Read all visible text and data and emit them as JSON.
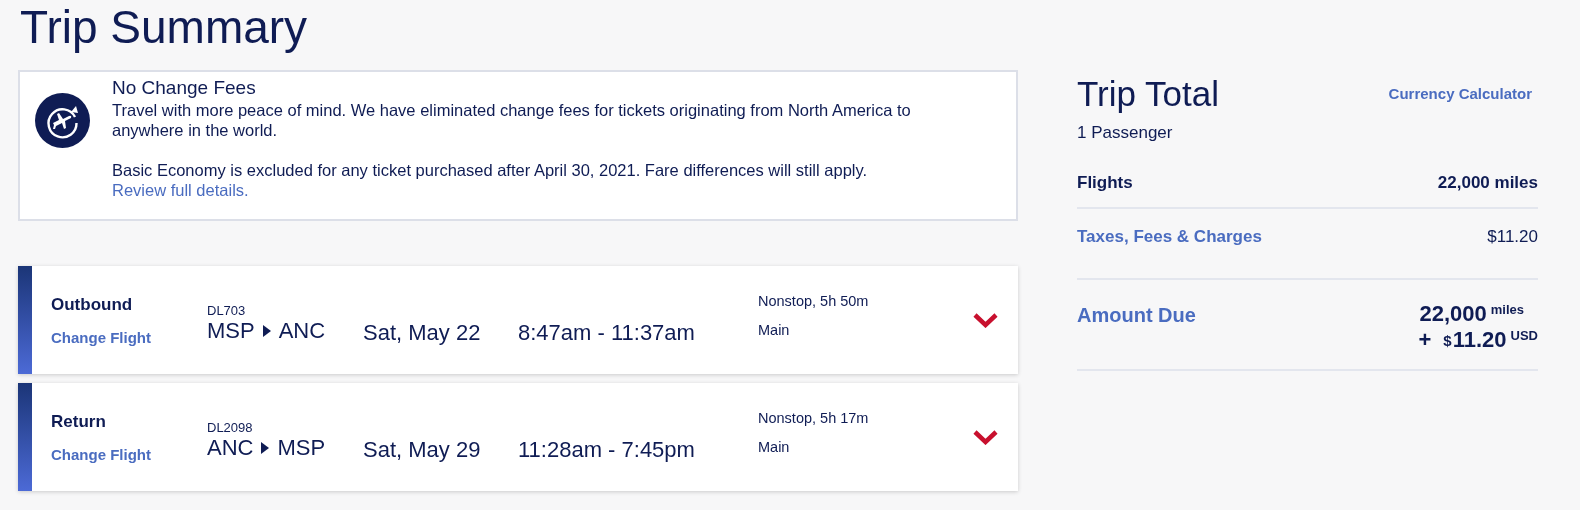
{
  "title": "Trip Summary",
  "notice": {
    "heading": "No Change Fees",
    "body": "Travel with more peace of mind. We have eliminated change fees for tickets originating from North America to anywhere in the world.",
    "note": "Basic Economy is excluded for any ticket purchased after April 30, 2021. Fare differences will still apply.",
    "link": "Review full details."
  },
  "flights": [
    {
      "direction": "Outbound",
      "change_link": "Change Flight",
      "flight_number": "DL703",
      "origin": "MSP",
      "destination": "ANC",
      "date": "Sat, May 22",
      "times": "8:47am - 11:37am",
      "stops": "Nonstop, 5h 50m",
      "cabin": "Main"
    },
    {
      "direction": "Return",
      "change_link": "Change Flight",
      "flight_number": "DL2098",
      "origin": "ANC",
      "destination": "MSP",
      "date": "Sat, May 29",
      "times": "11:28am - 7:45pm",
      "stops": "Nonstop, 5h 17m",
      "cabin": "Main"
    }
  ],
  "trip_total": {
    "heading": "Trip Total",
    "currency_link": "Currency Calculator",
    "passengers": "1 Passenger",
    "lines": [
      {
        "kind": "plain",
        "label": "Flights",
        "value": "22,000 miles"
      },
      {
        "kind": "link",
        "label": "Taxes, Fees & Charges",
        "value": "$11.20"
      }
    ],
    "amount_due": {
      "label": "Amount Due",
      "miles": "22,000",
      "miles_unit": "miles",
      "plus": "+",
      "currency_sign": "$",
      "cash": "11.20",
      "cash_unit": "USD"
    }
  }
}
